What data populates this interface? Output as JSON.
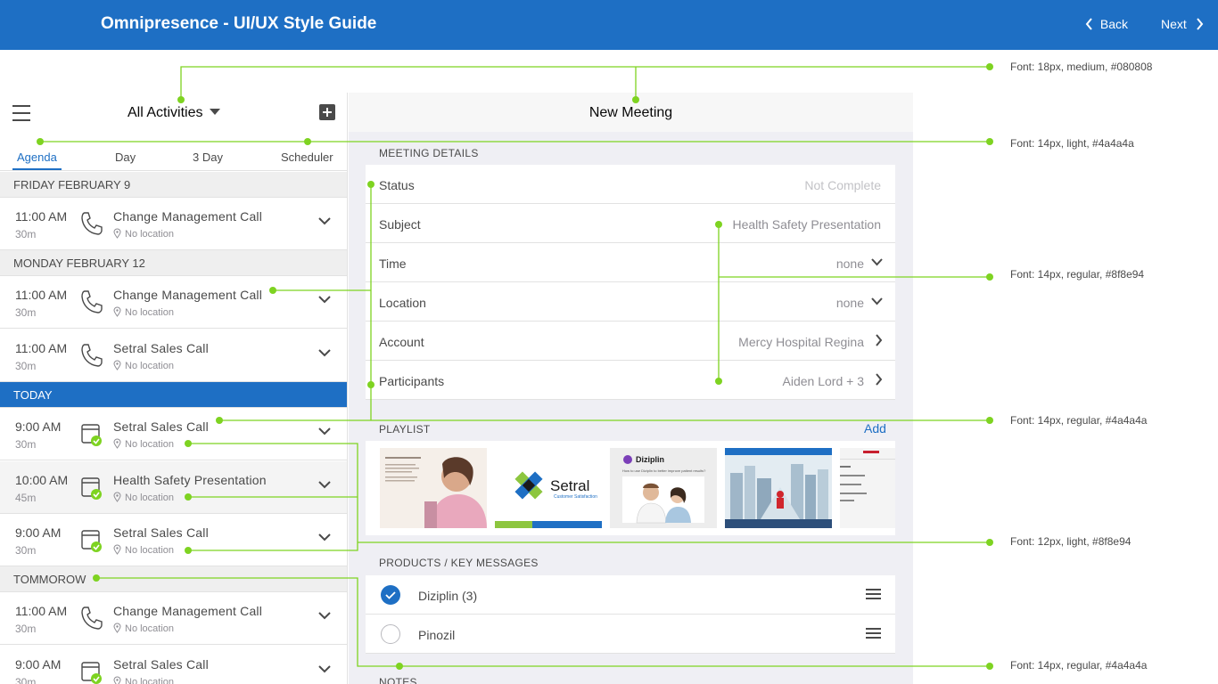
{
  "header": {
    "title": "Omnipresence - UI/UX Style Guide",
    "back_label": "Back",
    "next_label": "Next"
  },
  "left_panel": {
    "title": "All Activities",
    "tabs": [
      "Agenda",
      "Day",
      "3 Day",
      "Scheduler"
    ],
    "active_tab": "Agenda",
    "groups": {
      "friday": {
        "date": "FRIDAY FEBRUARY 9",
        "items": [
          {
            "time": "11:00 AM",
            "duration": "30m",
            "subject": "Change Management Call",
            "location": "No location",
            "icon": "phone-icon"
          }
        ]
      },
      "monday": {
        "date": "MONDAY FEBRUARY 12",
        "items": [
          {
            "time": "11:00 AM",
            "duration": "30m",
            "subject": "Change Management Call",
            "location": "No location",
            "icon": "phone-icon"
          },
          {
            "time": "11:00 AM",
            "duration": "30m",
            "subject": "Setral Sales Call",
            "location": "No location",
            "icon": "phone-icon"
          }
        ]
      },
      "today": {
        "date": "TODAY",
        "items": [
          {
            "time": "9:00 AM",
            "duration": "30m",
            "subject": "Setral Sales Call",
            "location": "No location",
            "icon": "meeting-check-icon"
          },
          {
            "time": "10:00 AM",
            "duration": "45m",
            "subject": "Health Safety Presentation",
            "location": "No location",
            "icon": "meeting-check-icon"
          },
          {
            "time": "9:00 AM",
            "duration": "30m",
            "subject": "Setral Sales Call",
            "location": "No location",
            "icon": "meeting-check-icon"
          }
        ]
      },
      "tomorrow": {
        "date": "TOMMOROW",
        "items": [
          {
            "time": "11:00 AM",
            "duration": "30m",
            "subject": "Change Management Call",
            "location": "No location",
            "icon": "phone-icon"
          },
          {
            "time": "9:00 AM",
            "duration": "30m",
            "subject": "Setral Sales Call",
            "location": "No location",
            "icon": "meeting-check-icon"
          }
        ]
      }
    }
  },
  "right_panel": {
    "title": "New Meeting",
    "details_header": "MEETING DETAILS",
    "fields": [
      {
        "label": "Status",
        "value": "Not Complete",
        "control": "none"
      },
      {
        "label": "Subject",
        "value": "Health Safety Presentation",
        "control": "none"
      },
      {
        "label": "Time",
        "value": "none",
        "control": "chevron-down-icon"
      },
      {
        "label": "Location",
        "value": "none",
        "control": "chevron-down-icon"
      },
      {
        "label": "Account",
        "value": "Mercy Hospital Regina",
        "control": "chevron-right-icon"
      },
      {
        "label": "Participants",
        "value": "Aiden Lord + 3",
        "control": "chevron-right-icon"
      }
    ],
    "playlist_header": "PLAYLIST",
    "playlist_add": "Add",
    "playlist_items": {
      "diziplin_title": "Diziplin",
      "diziplin_question": "How to use Diziplin to better improve patient results?",
      "setral_name": "Setral",
      "setral_tagline": "Customer Satisfaction"
    },
    "products_header": "PRODUCTS / KEY MESSAGES",
    "products": [
      {
        "name": "Diziplin (3)",
        "checked": true
      },
      {
        "name": "Pinozil",
        "checked": false
      }
    ],
    "notes_header": "NOTES"
  },
  "annotations": [
    "Font: 18px, medium, #080808",
    "Font: 14px, light, #4a4a4a",
    "Font: 14px, regular, #8f8e94",
    "Font: 14px, regular, #4a4a4a",
    "Font: 12px, light, #8f8e94",
    "Font: 14px, regular, #4a4a4a"
  ],
  "colors": {
    "brand": "#1e6fc4",
    "annotation": "#7ed321",
    "text_dark": "#080808",
    "text": "#4a4a4a",
    "text_muted": "#8f8e94"
  }
}
